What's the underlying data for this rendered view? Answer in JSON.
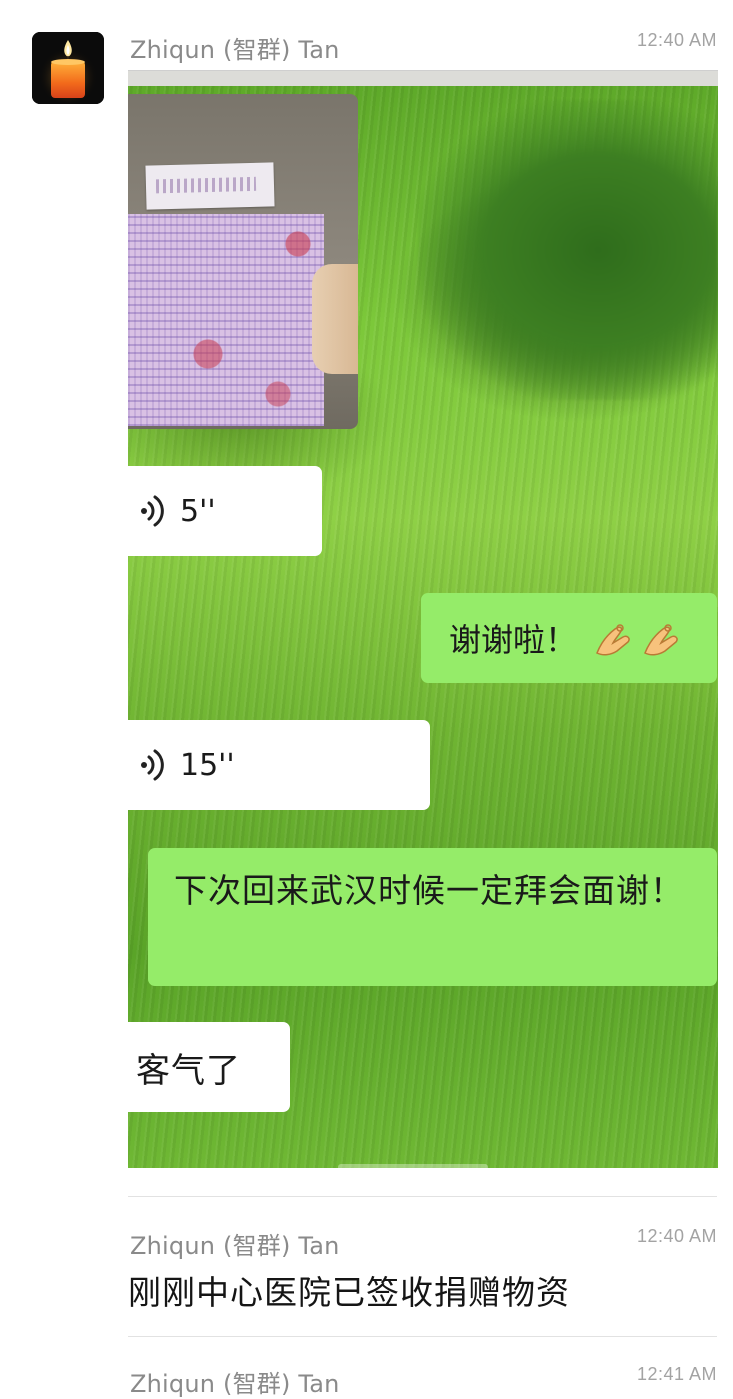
{
  "messages": [
    {
      "sender": "Zhiqun (智群) Tan",
      "time": "12:40 AM"
    },
    {
      "sender": "Zhiqun (智群) Tan",
      "time": "12:40 AM",
      "text": "刚刚中心医院已签收捐赠物资"
    },
    {
      "sender": "Zhiqun (智群) Tan",
      "time": "12:41 AM"
    }
  ],
  "avatar": {
    "icon": "candle-icon"
  },
  "screenshot": {
    "bubbles": {
      "voice1_duration": "5''",
      "thanks_text": "谢谢啦！",
      "thanks_emoji": "ok-hand-icon",
      "voice2_duration": "15''",
      "next_visit_text": "下次回来武汉时候一定拜会面谢！",
      "polite_text": "客气了"
    }
  },
  "colors": {
    "green_bubble": "#95ec69",
    "white_bubble": "#ffffff",
    "meta_text": "#8a8a8a"
  }
}
